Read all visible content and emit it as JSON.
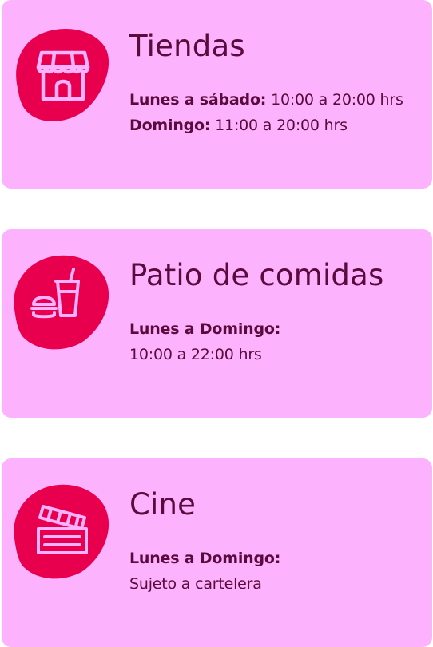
{
  "colors": {
    "card_bg": "#fdb2fd",
    "blob": "#e8004f",
    "icon_stroke": "#fdb2fd",
    "text": "#5a0a3c"
  },
  "cards": [
    {
      "icon": "store-icon",
      "title": "Tiendas",
      "line1_label": "Lunes a sábado:",
      "line1_value": "10:00 a 20:00 hrs",
      "line2_label": "Domingo:",
      "line2_value": "11:00 a 20:00 hrs"
    },
    {
      "icon": "fast-food-icon",
      "title": "Patio de comidas",
      "line1_label": "Lunes a Domingo:",
      "line2_value": "10:00 a 22:00 hrs"
    },
    {
      "icon": "clapperboard-icon",
      "title": "Cine",
      "line1_label": "Lunes a Domingo:",
      "line2_value": "Sujeto a cartelera"
    }
  ]
}
